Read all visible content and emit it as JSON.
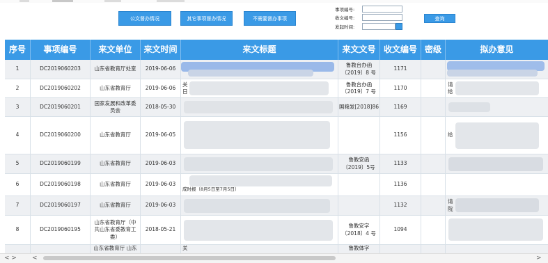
{
  "toolbar": {
    "btn1": "公文督办情况",
    "btn2": "其它事项督办情况",
    "btn3": "不需要督办事项",
    "query": "查询"
  },
  "filters": {
    "item_no_label": "事项编号:",
    "receipt_no_label": "收文编号:",
    "date_label": "发起时间:",
    "item_no_value": "",
    "receipt_no_value": "",
    "date_value": ""
  },
  "table": {
    "headers": [
      "序号",
      "事项编号",
      "来文单位",
      "来文时间",
      "来文标题",
      "来文文号",
      "收文编号",
      "密级",
      "拟办意见"
    ],
    "rows": [
      {
        "seq": "1",
        "item_no": "DC2019060203",
        "unit": "山东省教育厅处室",
        "date": "2019-06-06",
        "title": "",
        "doc_no": "鲁教台办函\n〔2019〕8 号",
        "recv_no": "1171",
        "secret": "",
        "opinion": ""
      },
      {
        "seq": "2",
        "item_no": "DC2019060202",
        "unit": "山东省教育厅",
        "date": "2019-06-06",
        "title": "关\n日",
        "doc_no": "鲁教台办函\n〔2019〕7 号",
        "recv_no": "1170",
        "secret": "",
        "opinion": "请\n给"
      },
      {
        "seq": "3",
        "item_no": "DC2019060201",
        "unit": "国家发展和改革委\n员会",
        "date": "2018-05-30",
        "title": "",
        "doc_no": "国粮发[2018]86",
        "recv_no": "1169",
        "secret": "",
        "opinion": ""
      },
      {
        "seq": "4",
        "item_no": "DC2019060200",
        "unit": "山东省教育厅",
        "date": "2019-06-05",
        "title": "",
        "doc_no": "",
        "recv_no": "1156",
        "secret": "",
        "opinion": "给"
      },
      {
        "seq": "5",
        "item_no": "DC2019060199",
        "unit": "山东省教育厅",
        "date": "2019-06-03",
        "title": "",
        "doc_no": "鲁教安函\n〔2019〕5号",
        "recv_no": "1133",
        "secret": "",
        "opinion": ""
      },
      {
        "seq": "6",
        "item_no": "DC2019060198",
        "unit": "山东省教育厅",
        "date": "2019-06-03",
        "title": "关\n于\n成时报（8月5日至7月5日）",
        "doc_no": "",
        "recv_no": "1136",
        "secret": "",
        "opinion": ""
      },
      {
        "seq": "7",
        "item_no": "DC2019060197",
        "unit": "山东省教育厅",
        "date": "2019-06-03",
        "title": "",
        "doc_no": "",
        "recv_no": "1132",
        "secret": "",
        "opinion": "请\n院"
      },
      {
        "seq": "8",
        "item_no": "DC2019060195",
        "unit": "山东省教育厅（中\n共山东省委教育工\n委）",
        "date": "2018-05-21",
        "title": "",
        "doc_no": "鲁教安字\n〔2018〕4 号",
        "recv_no": "1094",
        "secret": "",
        "opinion": ""
      },
      {
        "seq": "",
        "item_no": "",
        "unit": "山东省教育厅 山东",
        "date": "",
        "title": "关",
        "doc_no": "鲁教体字",
        "recv_no": "",
        "secret": "",
        "opinion": ""
      }
    ]
  },
  "colors": {
    "accent": "#3a9ae6",
    "header_text": "#ffffff",
    "row_alt": "#eef0f3"
  },
  "icons": {
    "calendar": "calendar-icon",
    "scroll_left": "chevron-left-icon",
    "scroll_right": "chevron-right-icon"
  },
  "scrollbar": {
    "left_glyphs": "< >",
    "left_arrow": "<",
    "right_arrow": ">"
  }
}
